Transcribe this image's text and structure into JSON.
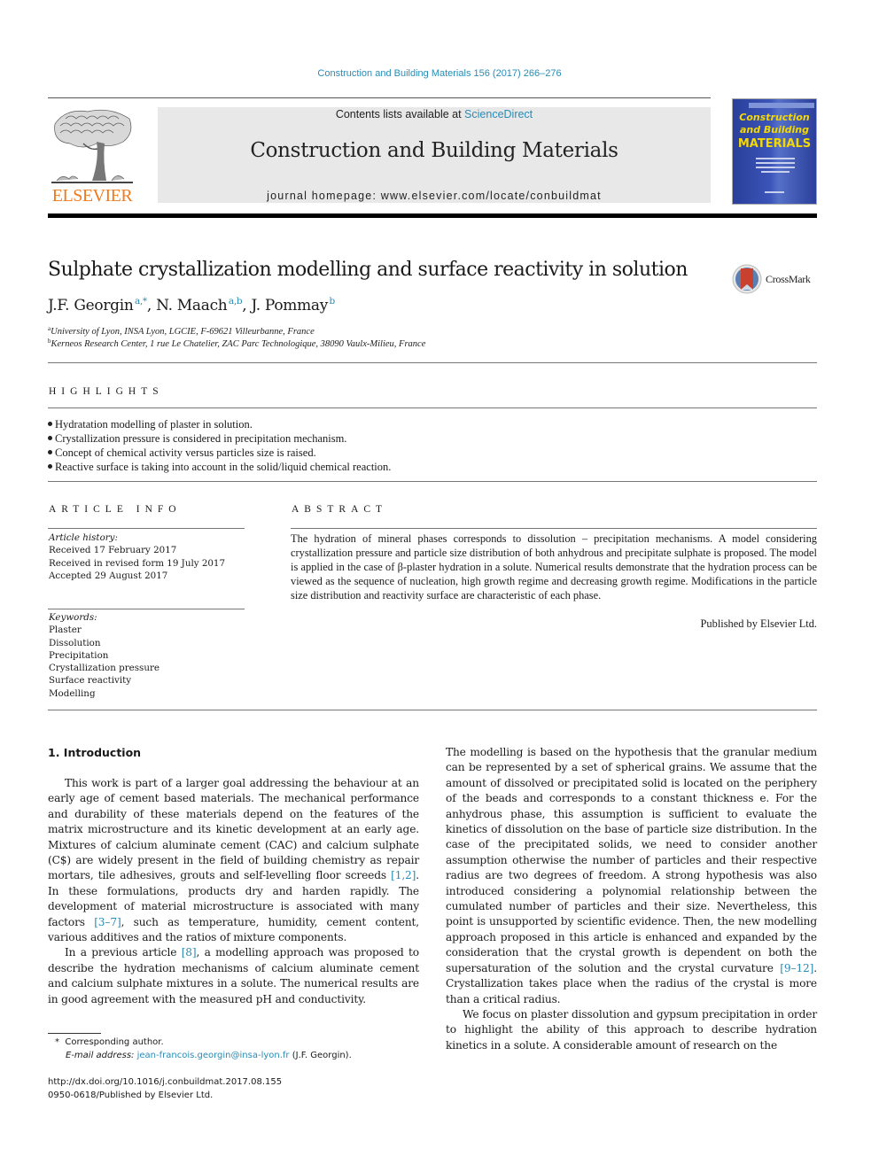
{
  "header": {
    "journal_reference": "Construction and Building Materials 156 (2017) 266–276",
    "contents_prefix": "Contents lists available at ",
    "contents_link": "ScienceDirect",
    "journal_title": "Construction and Building Materials",
    "homepage_line": "journal homepage: www.elsevier.com/locate/conbuildmat",
    "publisher_logo_text": "ELSEVIER",
    "cover": {
      "title_line1": "Construction",
      "title_line2": "and Building",
      "title_line3": "MATERIALS"
    },
    "colors": {
      "link": "#2a8bb5",
      "elsevier_orange": "#f07a1e",
      "cover_blue": "#2b3f9a",
      "cover_yellow": "#f5d800",
      "masthead_gray": "#e8e8e8"
    }
  },
  "article": {
    "title": "Sulphate crystallization modelling and surface reactivity in solution",
    "crossmark_label": "CrossMark",
    "authors": [
      {
        "name": "J.F. Georgin",
        "sup": "a,*",
        "sep": ", "
      },
      {
        "name": "N. Maach",
        "sup": "a,b",
        "sep": ", "
      },
      {
        "name": "J. Pommay",
        "sup": "b",
        "sep": ""
      }
    ],
    "affiliations": [
      {
        "mark": "a",
        "text": "University of Lyon, INSA Lyon, LGCIE, F-69621 Villeurbanne, France"
      },
      {
        "mark": "b",
        "text": "Kerneos Research Center, 1 rue Le Chatelier, ZAC Parc Technologique, 38090 Vaulx-Milieu, France"
      }
    ]
  },
  "highlights": {
    "heading": "HIGHLIGHTS",
    "items": [
      "Hydratation modelling of plaster in solution.",
      "Crystallization pressure is considered in precipitation mechanism.",
      "Concept of chemical activity versus particles size is raised.",
      "Reactive surface is taking into account in the solid/liquid chemical reaction."
    ]
  },
  "article_info": {
    "heading": "ARTICLE INFO",
    "history_label": "Article history:",
    "history": [
      "Received 17 February 2017",
      "Received in revised form 19 July 2017",
      "Accepted 29 August 2017"
    ],
    "keywords_label": "Keywords:",
    "keywords": [
      "Plaster",
      "Dissolution",
      "Precipitation",
      "Crystallization pressure",
      "Surface reactivity",
      "Modelling"
    ]
  },
  "abstract": {
    "heading": "ABSTRACT",
    "text": "The hydration of mineral phases corresponds to dissolution – precipitation mechanisms. A model considering crystallization pressure and particle size distribution of both anhydrous and precipitate sulphate is proposed. The model is applied in the case of β-plaster hydration in a solute. Numerical results demonstrate that the hydration process can be viewed as the sequence of nucleation, high growth regime and decreasing growth regime. Modifications in the particle size distribution and reactivity surface are characteristic of each phase.",
    "published_by": "Published by Elsevier Ltd."
  },
  "body": {
    "section_heading": "1. Introduction",
    "left": {
      "p1_a": "This work is part of a larger goal addressing the behaviour at an early age of cement based materials. The mechanical performance and durability of these materials depend on the features of the matrix microstructure and its kinetic development at an early age. Mixtures of calcium aluminate cement (CAC) and calcium sulphate (C$) are widely present in the field of building chemistry as repair mortars, tile adhesives, grouts and self-levelling floor screeds ",
      "p1_ref1": "[1,2]",
      "p1_b": ". In these formulations, products dry and harden rapidly. The development of material microstructure is associated with many factors ",
      "p1_ref2": "[3–7]",
      "p1_c": ", such as temperature, humidity, cement content, various additives and the ratios of mixture components.",
      "p2_a": "In a previous article ",
      "p2_ref": "[8]",
      "p2_b": ", a modelling approach was proposed to describe the hydration mechanisms of calcium aluminate cement and calcium sulphate mixtures in a solute. The numerical results are in good agreement with the measured pH and conductivity."
    },
    "right": {
      "p1_a": "The modelling is based on the hypothesis that the granular medium can be represented by a set of spherical grains. We assume that the amount of dissolved or precipitated solid is located on the periphery of the beads and corresponds to a constant thickness e. For the anhydrous phase, this assumption is sufficient to evaluate the kinetics of dissolution on the base of particle size distribution. In the case of the precipitated solids, we need to consider another assumption otherwise the number of particles and their respective radius are two degrees of freedom. A strong hypothesis was also introduced considering a polynomial relationship between the cumulated number of particles and their size. Nevertheless, this point is unsupported by scientific evidence. Then, the new modelling approach proposed in this article is enhanced and expanded by the consideration that the crystal growth is dependent on both the supersaturation of the solution and the crystal curvature ",
      "p1_ref": "[9–12]",
      "p1_b": ". Crystallization takes place when the radius of the crystal is more than a critical radius.",
      "p2": "We focus on plaster dissolution and gypsum precipitation in order to highlight the ability of this approach to describe hydration kinetics in a solute. A considerable amount of research on the"
    }
  },
  "footnotes": {
    "corresponding_mark": "*",
    "corresponding_text": "Corresponding author.",
    "email_label": "E-mail address:",
    "email": "jean-francois.georgin@insa-lyon.fr",
    "email_owner": "(J.F. Georgin).",
    "doi": "http://dx.doi.org/10.1016/j.conbuildmat.2017.08.155",
    "issn_line": "0950-0618/Published by Elsevier Ltd."
  }
}
